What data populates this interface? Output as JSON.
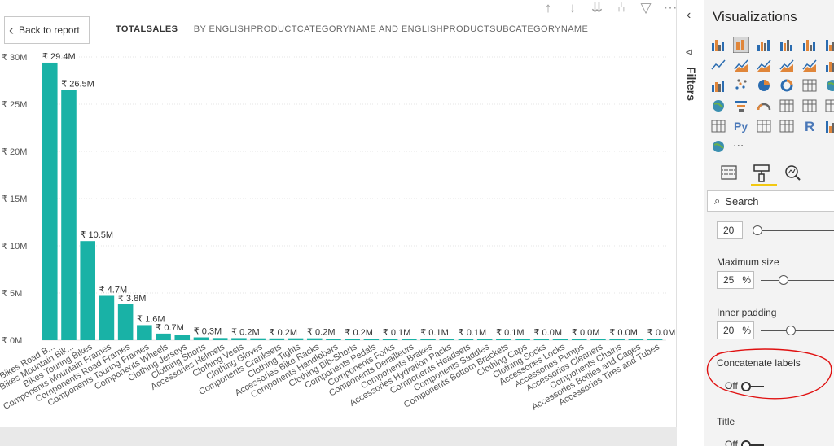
{
  "report": {
    "back_label": "Back to report",
    "title_measure": "TOTALSALES",
    "title_by": "BY ENGLISHPRODUCTCATEGORYNAME AND ENGLISHPRODUCTSUBCATEGORYNAME",
    "toolbar_icons": [
      "arrow-up-icon",
      "arrow-down-icon",
      "double-arrow-down-icon",
      "expand-hierarchy-icon",
      "filter-icon",
      "more-options-icon"
    ]
  },
  "chart_data": {
    "type": "bar",
    "title": "",
    "categories": [
      "Bikes Road B...",
      "Bikes Mountain Bik...",
      "Bikes Touring Bikes",
      "Components Mountain Frames",
      "Components Road Frames",
      "Components Touring Frames",
      "Components Wheels",
      "Clothing Jerseys",
      "Clothing Shorts",
      "Accessories Helmets",
      "Clothing Vests",
      "Clothing Gloves",
      "Components Cranksets",
      "Clothing Tights",
      "Accessories Bike Racks",
      "Components Handlebars",
      "Clothing Bib-Shorts",
      "Components Pedals",
      "Components Forks",
      "Components Derailleurs",
      "Components Brakes",
      "Accessories Hydration Packs",
      "Components Headsets",
      "Components Saddles",
      "Components Bottom Brackets",
      "Clothing Caps",
      "Clothing Socks",
      "Accessories Locks",
      "Accessories Pumps",
      "Accessories Cleaners",
      "Components Chains",
      "Accessories Bottles and Cages",
      "Accessories Tires and Tubes"
    ],
    "values": [
      29.4,
      26.5,
      10.5,
      4.7,
      3.8,
      1.6,
      0.7,
      0.6,
      0.3,
      0.23,
      0.22,
      0.2,
      0.19,
      0.2,
      0.2,
      0.17,
      0.17,
      0.15,
      0.1,
      0.1,
      0.08,
      0.1,
      0.1,
      0.07,
      0.1,
      0.05,
      0.03,
      0.02,
      0.02,
      0.02,
      0.01,
      0.01,
      0.01
    ],
    "data_labels": [
      "₹ 29.4M",
      "₹ 26.5M",
      "₹ 10.5M",
      "₹ 4.7M",
      "₹ 3.8M",
      "₹ 1.6M",
      "₹ 0.7M",
      "",
      "₹ 0.3M",
      "",
      "₹ 0.2M",
      "",
      "₹ 0.2M",
      "",
      "₹ 0.2M",
      "",
      "₹ 0.2M",
      "",
      "₹ 0.1M",
      "",
      "₹ 0.1M",
      "",
      "₹ 0.1M",
      "",
      "₹ 0.1M",
      "",
      "₹ 0.0M",
      "",
      "₹ 0.0M",
      "",
      "₹ 0.0M",
      "",
      "₹ 0.0M"
    ],
    "y_ticks": [
      0,
      5,
      10,
      15,
      20,
      25,
      30
    ],
    "y_tick_labels": [
      "₹ 0M",
      "₹ 5M",
      "₹ 10M",
      "₹ 15M",
      "₹ 20M",
      "₹ 25M",
      "₹ 30M"
    ],
    "ylim": [
      0,
      30
    ],
    "bar_color": "#19b2a6",
    "grid": true,
    "xlabel": "",
    "ylabel": ""
  },
  "panel": {
    "filters_label": "Filters",
    "collapse_icon": "chevron-left-icon"
  },
  "viz": {
    "title": "Visualizations",
    "more_label": "...",
    "tabs": [
      "fields-icon",
      "format-paint-roller-icon",
      "analytics-magnifier-icon"
    ],
    "search_placeholder": "Search",
    "min_size_value": "20",
    "max_size_label": "Maximum size",
    "max_size_value": "25",
    "max_size_unit": "%",
    "inner_padding_label": "Inner padding",
    "inner_padding_value": "20",
    "inner_padding_unit": "%",
    "concat_label": "Concatenate labels",
    "concat_state": "Off",
    "title_label": "Title",
    "title_state": "Off"
  }
}
